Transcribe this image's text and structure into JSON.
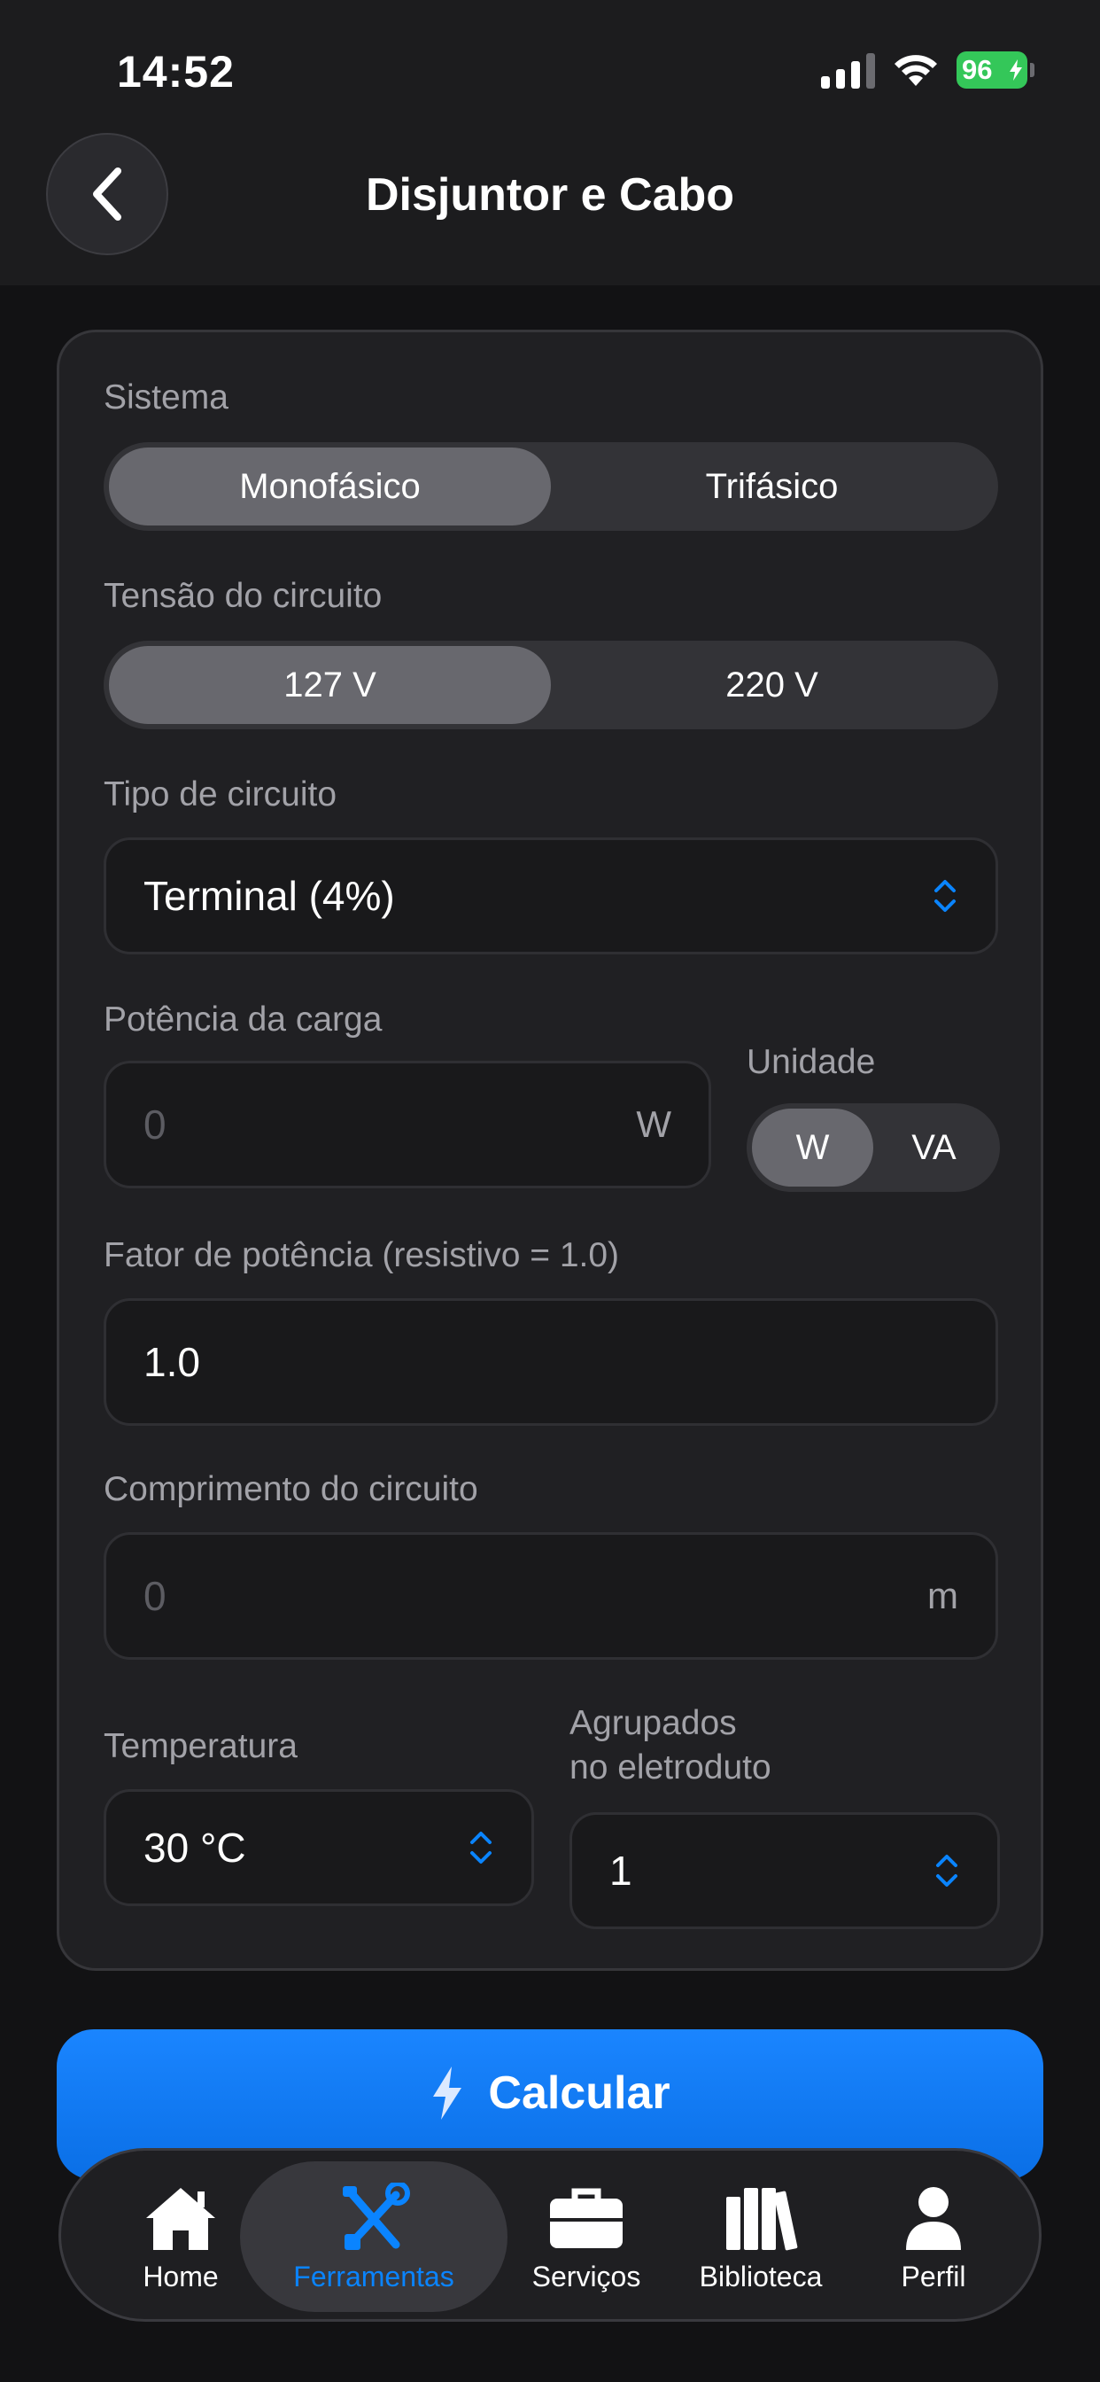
{
  "status_bar": {
    "time": "14:52",
    "battery": "96"
  },
  "header": {
    "title": "Disjuntor e Cabo",
    "back_icon": "chevron-left-icon"
  },
  "form": {
    "sistema": {
      "label": "Sistema",
      "options": [
        "Monofásico",
        "Trifásico"
      ],
      "selected": "Monofásico"
    },
    "tensao": {
      "label": "Tensão do circuito",
      "options": [
        "127 V",
        "220 V"
      ],
      "selected": "127 V"
    },
    "tipo_circuito": {
      "label": "Tipo de circuito",
      "value": "Terminal (4%)"
    },
    "potencia": {
      "label": "Potência da carga",
      "placeholder": "0",
      "unit": "W"
    },
    "unidade": {
      "label": "Unidade",
      "options": [
        "W",
        "VA"
      ],
      "selected": "W"
    },
    "fator": {
      "label": "Fator de potência (resistivo = 1.0)",
      "value": "1.0"
    },
    "comprimento": {
      "label": "Comprimento do circuito",
      "placeholder": "0",
      "unit": "m"
    },
    "temperatura": {
      "label": "Temperatura",
      "value": "30 °C"
    },
    "agrupados": {
      "label_line1": "Agrupados",
      "label_line2": "no eletroduto",
      "value": "1"
    }
  },
  "actions": {
    "calculate_label": "Calcular",
    "calculate_icon": "bolt-icon"
  },
  "tabbar": {
    "items": [
      {
        "label": "Home",
        "icon": "house-icon"
      },
      {
        "label": "Ferramentas",
        "icon": "tools-icon",
        "active": true
      },
      {
        "label": "Serviços",
        "icon": "briefcase-icon"
      },
      {
        "label": "Biblioteca",
        "icon": "books-icon"
      },
      {
        "label": "Perfil",
        "icon": "person-icon"
      }
    ]
  },
  "colors": {
    "accent": "#0a84ff",
    "background": "#121214",
    "card": "#202023",
    "battery": "#34c759"
  }
}
